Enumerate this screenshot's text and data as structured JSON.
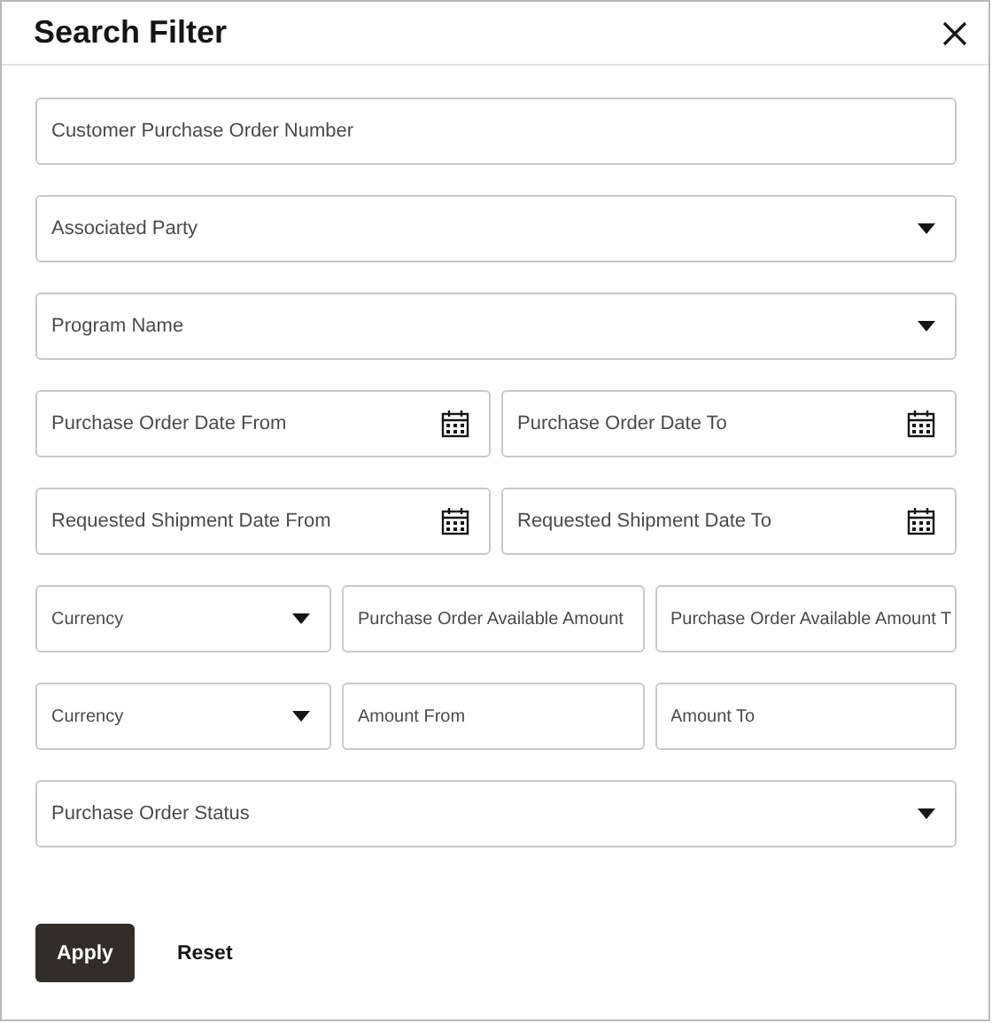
{
  "dialog": {
    "title": "Search Filter"
  },
  "rows": [
    {
      "fields": [
        {
          "kind": "text",
          "placeholder": "Customer Purchase Order Number"
        }
      ]
    },
    {
      "fields": [
        {
          "kind": "select",
          "placeholder": "Associated Party"
        }
      ]
    },
    {
      "fields": [
        {
          "kind": "select",
          "placeholder": "Program Name"
        }
      ]
    },
    {
      "fields": [
        {
          "kind": "date",
          "placeholder": "Purchase Order Date From"
        },
        {
          "kind": "date",
          "placeholder": "Purchase Order Date To"
        }
      ]
    },
    {
      "fields": [
        {
          "kind": "date",
          "placeholder": "Requested Shipment Date From"
        },
        {
          "kind": "date",
          "placeholder": "Requested Shipment Date To"
        }
      ]
    },
    {
      "fields": [
        {
          "kind": "select",
          "placeholder": "Currency"
        },
        {
          "kind": "text",
          "placeholder": "Purchase Order Available Amount"
        },
        {
          "kind": "text",
          "placeholder": "Purchase Order Available Amount T"
        }
      ]
    },
    {
      "fields": [
        {
          "kind": "select",
          "placeholder": "Currency"
        },
        {
          "kind": "text",
          "placeholder": "Amount From"
        },
        {
          "kind": "text",
          "placeholder": "Amount To"
        }
      ]
    },
    {
      "fields": [
        {
          "kind": "select",
          "placeholder": "Purchase Order Status"
        }
      ]
    }
  ],
  "buttons": [
    {
      "label": "Apply",
      "kind": "primary"
    },
    {
      "label": "Reset",
      "kind": "plain"
    }
  ]
}
